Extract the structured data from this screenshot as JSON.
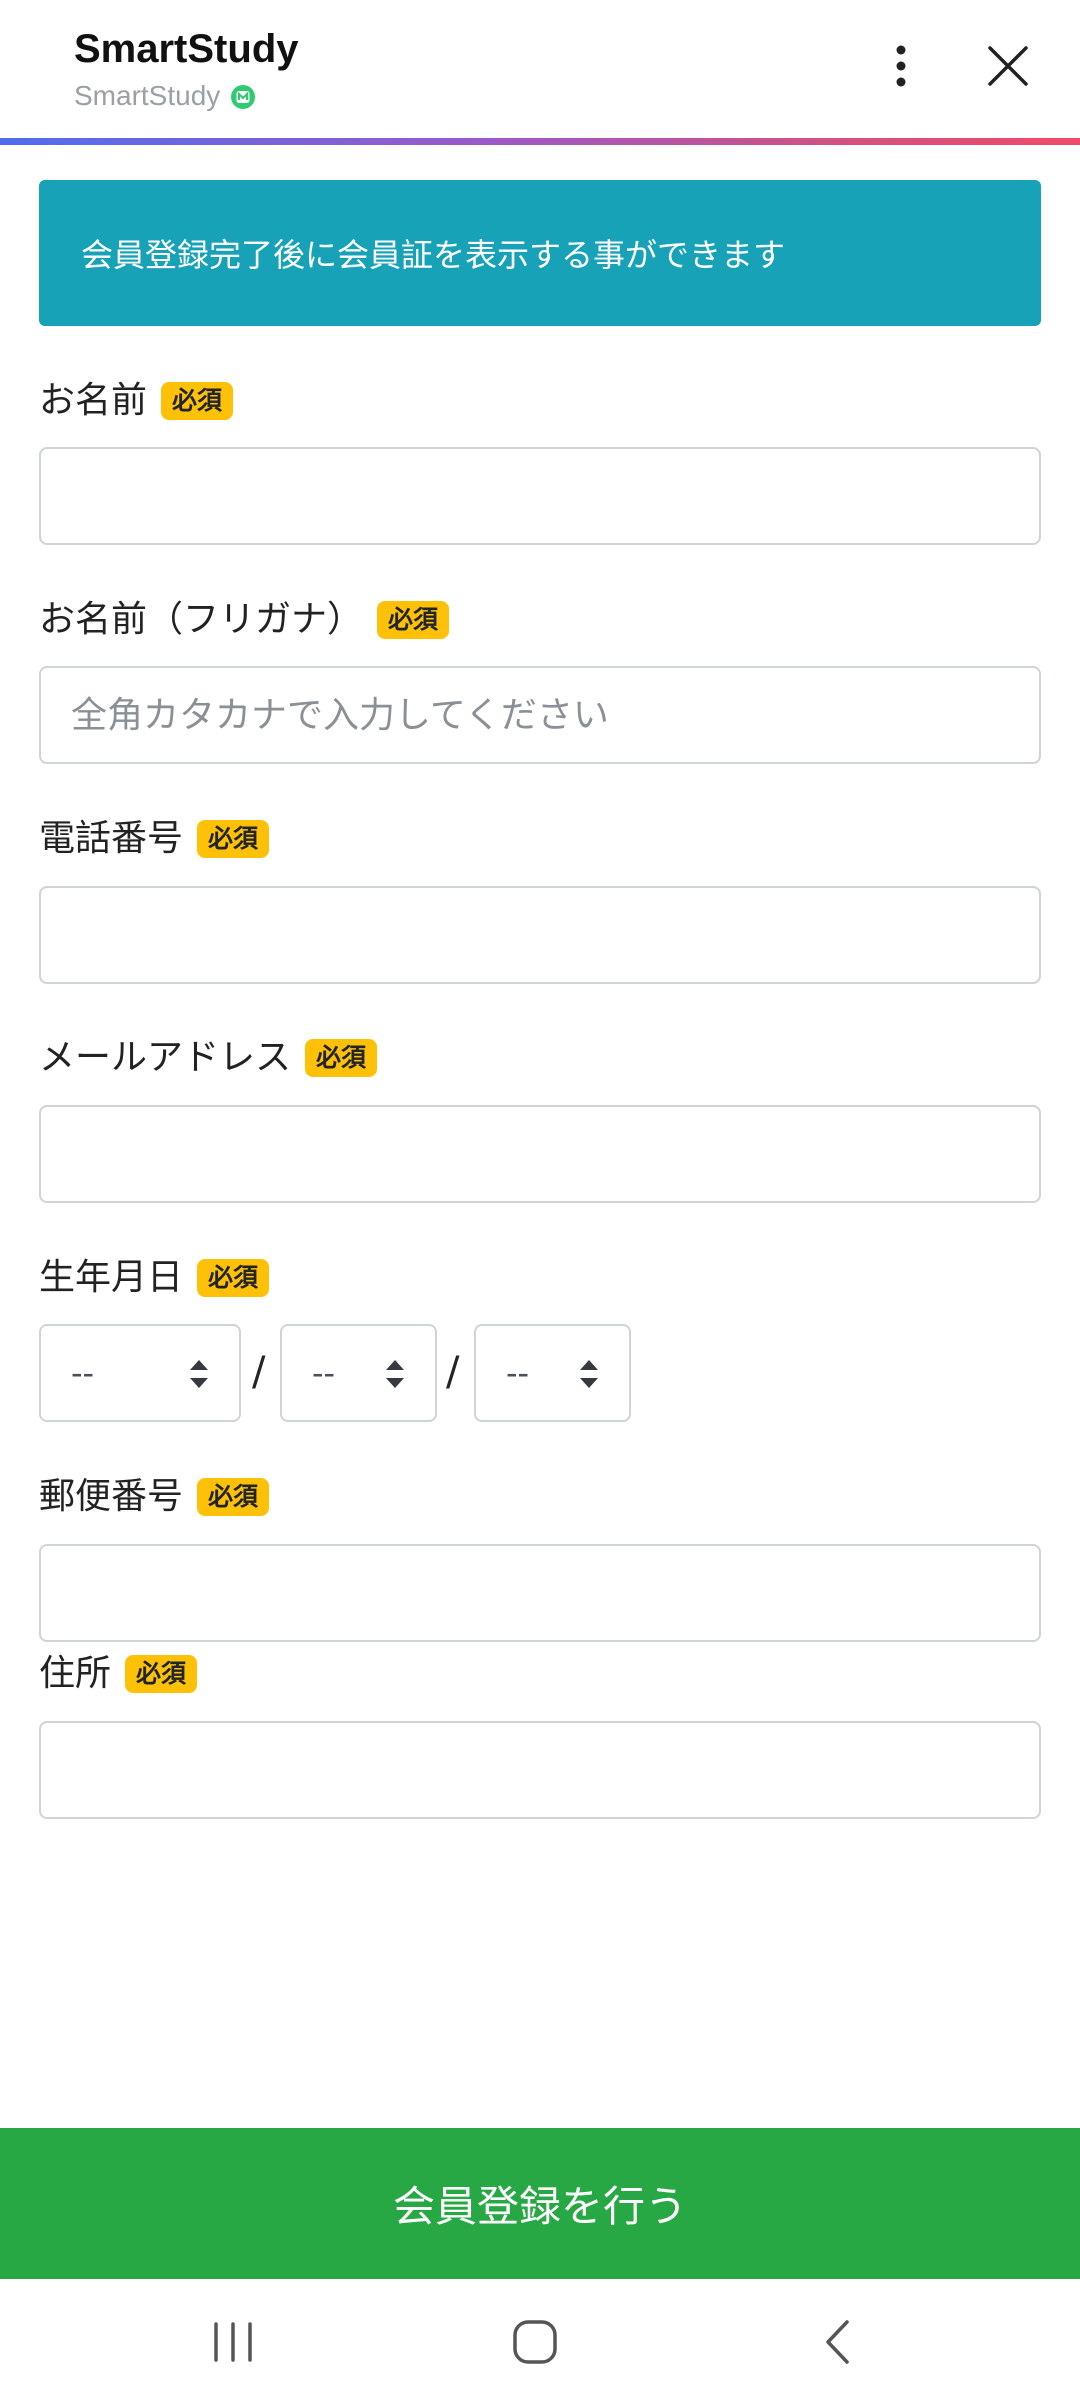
{
  "header": {
    "title": "SmartStudy",
    "subtitle": "SmartStudy",
    "icons": {
      "verified": "verified-badge-icon",
      "more": "more-vertical-icon",
      "close": "close-icon"
    }
  },
  "banner": {
    "text": "会員登録完了後に会員証を表示する事ができます"
  },
  "form": {
    "required_badge": "必須",
    "name": {
      "label": "お名前",
      "value": "",
      "placeholder": ""
    },
    "name_kana": {
      "label": "お名前（フリガナ）",
      "value": "",
      "placeholder": "全角カタカナで入力してください"
    },
    "phone": {
      "label": "電話番号",
      "value": "",
      "placeholder": ""
    },
    "email": {
      "label": "メールアドレス",
      "value": "",
      "placeholder": ""
    },
    "birthday": {
      "label": "生年月日",
      "year": "--",
      "month": "--",
      "day": "--",
      "separator": "/"
    },
    "postal_code": {
      "label": "郵便番号",
      "value": "",
      "placeholder": ""
    },
    "address": {
      "label": "住所",
      "value": "",
      "placeholder": ""
    }
  },
  "submit": {
    "label": "会員登録を行う"
  },
  "colors": {
    "banner": "#17a2b8",
    "badge": "#ffc107",
    "submit": "#28a745",
    "verified": "#2ecc71"
  },
  "nav": {
    "icons": [
      "recent-apps-icon",
      "home-icon",
      "back-icon"
    ]
  }
}
